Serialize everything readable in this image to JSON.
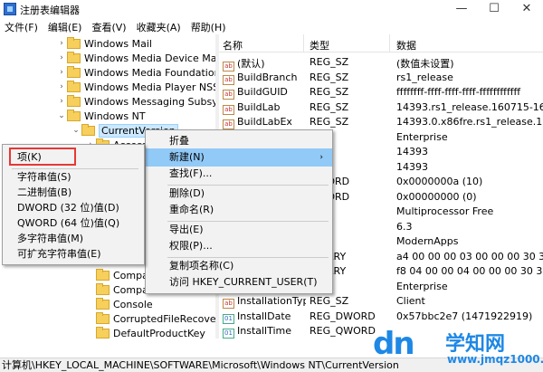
{
  "window": {
    "title": "注册表编辑器",
    "minimize": "—",
    "maximize": "☐",
    "close": "✕"
  },
  "menu": [
    "文件(F)",
    "编辑(E)",
    "查看(V)",
    "收藏夹(A)",
    "帮助(H)"
  ],
  "tree": [
    {
      "label": "Windows Mail",
      "arrow": "›"
    },
    {
      "label": "Windows Media Device Ma",
      "arrow": "›"
    },
    {
      "label": "Windows Media Foundatior",
      "arrow": "›"
    },
    {
      "label": "Windows Media Player NSS",
      "arrow": "›"
    },
    {
      "label": "Windows Messaging Subsys",
      "arrow": "›"
    },
    {
      "label": "Windows NT",
      "arrow": "⌄"
    },
    {
      "label": "CurrentVersion",
      "arrow": "⌄"
    },
    {
      "label": "Accessi",
      "arrow": "›"
    },
    {
      "label": "Compa",
      "arrow": ""
    },
    {
      "label": "Compa",
      "arrow": ""
    },
    {
      "label": "Console",
      "arrow": ""
    },
    {
      "label": "CorruptedFileRecove",
      "arrow": ""
    },
    {
      "label": "DefaultProductKey",
      "arrow": ""
    }
  ],
  "list": {
    "headers": {
      "name": "名称",
      "type": "类型",
      "data": "数据"
    },
    "rows": [
      {
        "name": "(默认)",
        "type": "REG_SZ",
        "data": "(数值未设置)"
      },
      {
        "name": "BuildBranch",
        "type": "REG_SZ",
        "data": "rs1_release"
      },
      {
        "name": "BuildGUID",
        "type": "REG_SZ",
        "data": "ffffffff-ffff-ffff-ffff-ffffffffffff"
      },
      {
        "name": "BuildLab",
        "type": "REG_SZ",
        "data": "14393.rs1_release.160715-1616"
      },
      {
        "name": "BuildLabEx",
        "type": "REG_SZ",
        "data": "14393.0.x86fre.rs1_release.1607"
      },
      {
        "name": "",
        "type": "",
        "data": "Enterprise"
      },
      {
        "name": "",
        "type": "",
        "data": "14393"
      },
      {
        "name": "",
        "type": "",
        "data": "14393"
      },
      {
        "name": "",
        "type": "DWORD",
        "data": "0x0000000a (10)"
      },
      {
        "name": "",
        "type": "DWORD",
        "data": "0x00000000 (0)"
      },
      {
        "name": "",
        "type": "",
        "data": "Multiprocessor Free"
      },
      {
        "name": "",
        "type": "",
        "data": "6.3"
      },
      {
        "name": "",
        "type": "",
        "data": "ModernApps"
      },
      {
        "name": "",
        "type": "BINARY",
        "data": "a4 00 00 00 03 00 00 00 30 30"
      },
      {
        "name": "",
        "type": "BINARY",
        "data": "f8 04 00 00 04 00 00 00 30 30"
      },
      {
        "name": "",
        "type": "",
        "data": "Enterprise"
      },
      {
        "name": "InstallationType",
        "type": "REG_SZ",
        "data": "Client"
      },
      {
        "name": "InstallDate",
        "type": "REG_DWORD",
        "data": "0x57bbc2e7 (1471922919)"
      },
      {
        "name": "InstallTime",
        "type": "REG_QWORD",
        "data": ""
      }
    ]
  },
  "context_menu": [
    "折叠",
    "新建(N)",
    "查找(F)...",
    "删除(D)",
    "重命名(R)",
    "导出(E)",
    "权限(P)...",
    "复制项名称(C)",
    "访问 HKEY_CURRENT_USER(T)"
  ],
  "submenu": [
    "项(K)",
    "字符串值(S)",
    "二进制值(B)",
    "DWORD (32 位)值(D)",
    "QWORD (64 位)值(Q)",
    "多字符串值(M)",
    "可扩充字符串值(E)"
  ],
  "status": "计算机\\HKEY_LOCAL_MACHINE\\SOFTWARE\\Microsoft\\Windows NT\\CurrentVersion",
  "watermark": {
    "logo": "dn",
    "cn": "学知网",
    "url": "www.jmqz1000.com"
  },
  "colors": {
    "selection": "#cce8ff",
    "menu_highlight": "#91c9f7",
    "red_box": "#e53935",
    "watermark": "#1e88e5"
  }
}
